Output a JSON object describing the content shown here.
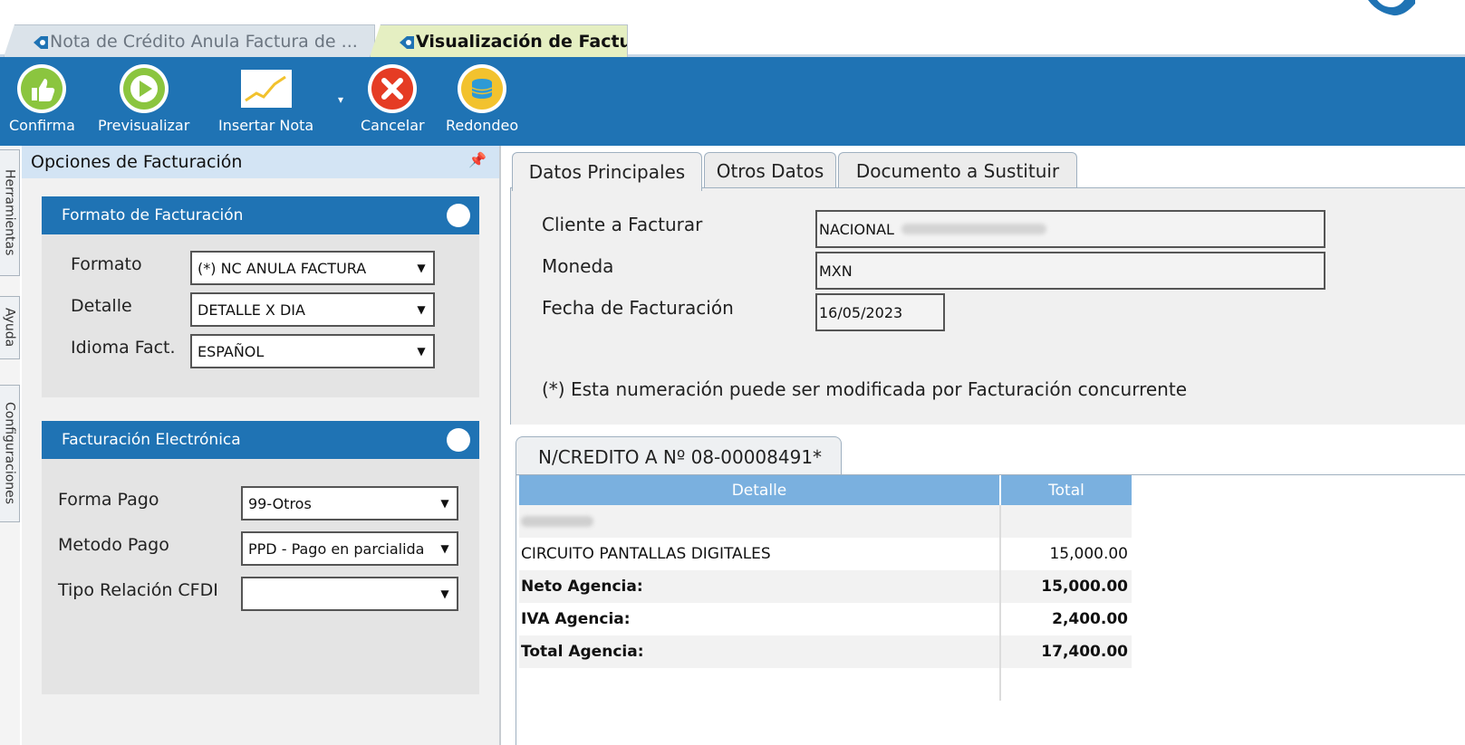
{
  "doc_tabs": [
    {
      "label": "Nota de Crédito Anula Factura de ...",
      "icon": "document-tab-icon"
    },
    {
      "label": "Visualización de Factura",
      "icon": "document-tab-icon"
    }
  ],
  "toolbar": {
    "buttons": [
      {
        "label": "Confirma",
        "icon": "thumbs-up-icon"
      },
      {
        "label": "Previsualizar",
        "icon": "play-icon"
      },
      {
        "label": "Insertar Nota",
        "icon": "chart-note-icon"
      },
      {
        "label": "Cancelar",
        "icon": "close-icon"
      },
      {
        "label": "Redondeo",
        "icon": "coins-icon"
      }
    ],
    "dropdown_arrow": "▾"
  },
  "side_tabs": [
    "Herramientas",
    "Ayuda",
    "Configuraciones"
  ],
  "left_panel": {
    "title": "Opciones de Facturación",
    "pin": "📌",
    "formato_group": {
      "title": "Formato de Facturación",
      "fields": [
        {
          "label": "Formato",
          "value": "(*) NC ANULA FACTURA"
        },
        {
          "label": "Detalle",
          "value": "DETALLE X DIA"
        },
        {
          "label": "Idioma Fact.",
          "value": "ESPAÑOL"
        }
      ]
    },
    "electronica_group": {
      "title": "Facturación Electrónica",
      "fields": [
        {
          "label": "Forma Pago",
          "value": "99-Otros"
        },
        {
          "label": "Metodo Pago",
          "value": "PPD - Pago en parcialida"
        },
        {
          "label": "Tipo Relación CFDI",
          "value": ""
        }
      ]
    }
  },
  "main_tabs": [
    "Datos Principales",
    "Otros Datos",
    "Documento a Sustituir"
  ],
  "datos_principales": {
    "cliente_label": "Cliente a Facturar",
    "cliente_value": "NACIONAL",
    "moneda_label": "Moneda",
    "moneda_value": "MXN",
    "fecha_label": "Fecha de Facturación",
    "fecha_value": "16/05/2023",
    "note": "(*) Esta numeración puede ser modificada por Facturación concurrente"
  },
  "credit_note": {
    "tab_label": "N/CREDITO A Nº 08-00008491*",
    "columns": [
      "Detalle",
      "Total"
    ],
    "rows": [
      {
        "detalle": "",
        "total": ""
      },
      {
        "detalle": "CIRCUITO PANTALLAS DIGITALES",
        "total": "15,000.00"
      },
      {
        "detalle": "Neto Agencia:",
        "total": "15,000.00"
      },
      {
        "detalle": "IVA Agencia:",
        "total": "2,400.00"
      },
      {
        "detalle": "Total Agencia:",
        "total": "17,400.00"
      },
      {
        "detalle": "",
        "total": ""
      }
    ]
  },
  "colors": {
    "toolbar": "#1f73b4",
    "grid_header": "#7ab0df",
    "active_doc_tab": "#e5efc2"
  }
}
